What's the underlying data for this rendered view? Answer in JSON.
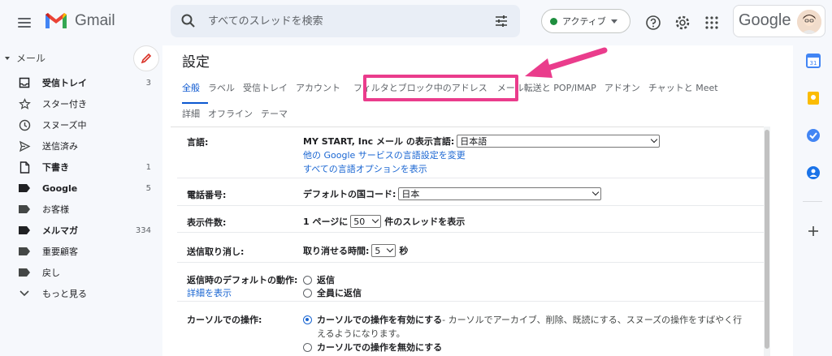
{
  "app": {
    "name": "Gmail"
  },
  "search": {
    "placeholder": "すべてのスレッドを検索"
  },
  "status": {
    "label": "アクティブ"
  },
  "account": {
    "label": "Google"
  },
  "nav": {
    "section": "メール",
    "items": [
      {
        "label": "受信トレイ",
        "count": "3",
        "icon": "inbox-icon",
        "bold": true
      },
      {
        "label": "スター付き",
        "count": "",
        "icon": "star-icon",
        "bold": false
      },
      {
        "label": "スヌーズ中",
        "count": "",
        "icon": "clock-icon",
        "bold": false
      },
      {
        "label": "送信済み",
        "count": "",
        "icon": "send-icon",
        "bold": false
      },
      {
        "label": "下書き",
        "count": "1",
        "icon": "draft-icon",
        "bold": true
      },
      {
        "label": "Google",
        "count": "5",
        "icon": "label-icon",
        "bold": true
      },
      {
        "label": "お客様",
        "count": "",
        "icon": "label-icon",
        "bold": false
      },
      {
        "label": "メルマガ",
        "count": "334",
        "icon": "label-icon",
        "bold": true
      },
      {
        "label": "重要顧客",
        "count": "",
        "icon": "label-icon",
        "bold": false
      },
      {
        "label": "戻し",
        "count": "",
        "icon": "label-icon",
        "bold": false
      },
      {
        "label": "もっと見る",
        "count": "",
        "icon": "chevron-down-icon",
        "bold": false
      }
    ]
  },
  "settings": {
    "title": "設定",
    "tabs_row1": [
      "全般",
      "ラベル",
      "受信トレイ",
      "アカウント",
      "フィルタとブロック中のアドレス",
      "メール転送と POP/IMAP",
      "アドオン",
      "チャットと Meet"
    ],
    "tabs_row2": [
      "詳細",
      "オフライン",
      "テーマ"
    ],
    "active_tab": "全般",
    "highlighted_tab": "フィルタとブロック中のアドレス",
    "language": {
      "label": "言語:",
      "prefix": "MY START, Inc メール の表示言語:",
      "value": "日本語",
      "link1": "他の Google サービスの言語設定を変更",
      "link2": "すべての言語オプションを表示"
    },
    "phone": {
      "label": "電話番号:",
      "prefix": "デフォルトの国コード:",
      "value": "日本"
    },
    "page_size": {
      "label": "表示件数:",
      "prefix": "1 ページに",
      "value": "50",
      "suffix": "件のスレッドを表示"
    },
    "undo_send": {
      "label": "送信取り消し:",
      "prefix": "取り消せる時間:",
      "value": "5",
      "suffix": "秒"
    },
    "reply_default": {
      "label": "返信時のデフォルトの動作:",
      "link": "詳細を表示",
      "option1": "返信",
      "option2": "全員に返信"
    },
    "cursor": {
      "label": "カーソルでの操作:",
      "option1_bold": "カーソルでの操作を有効にする",
      "option1_rest": " - カーソルでアーカイブ、削除、既読にする、スヌーズの操作をすばやく行",
      "option1_line2": "えるようになります。",
      "option2": "カーソルでの操作を無効にする"
    }
  },
  "colors": {
    "highlight": "#ea3c8c",
    "link": "#1a66d2",
    "active_tab": "#0b57d0"
  }
}
